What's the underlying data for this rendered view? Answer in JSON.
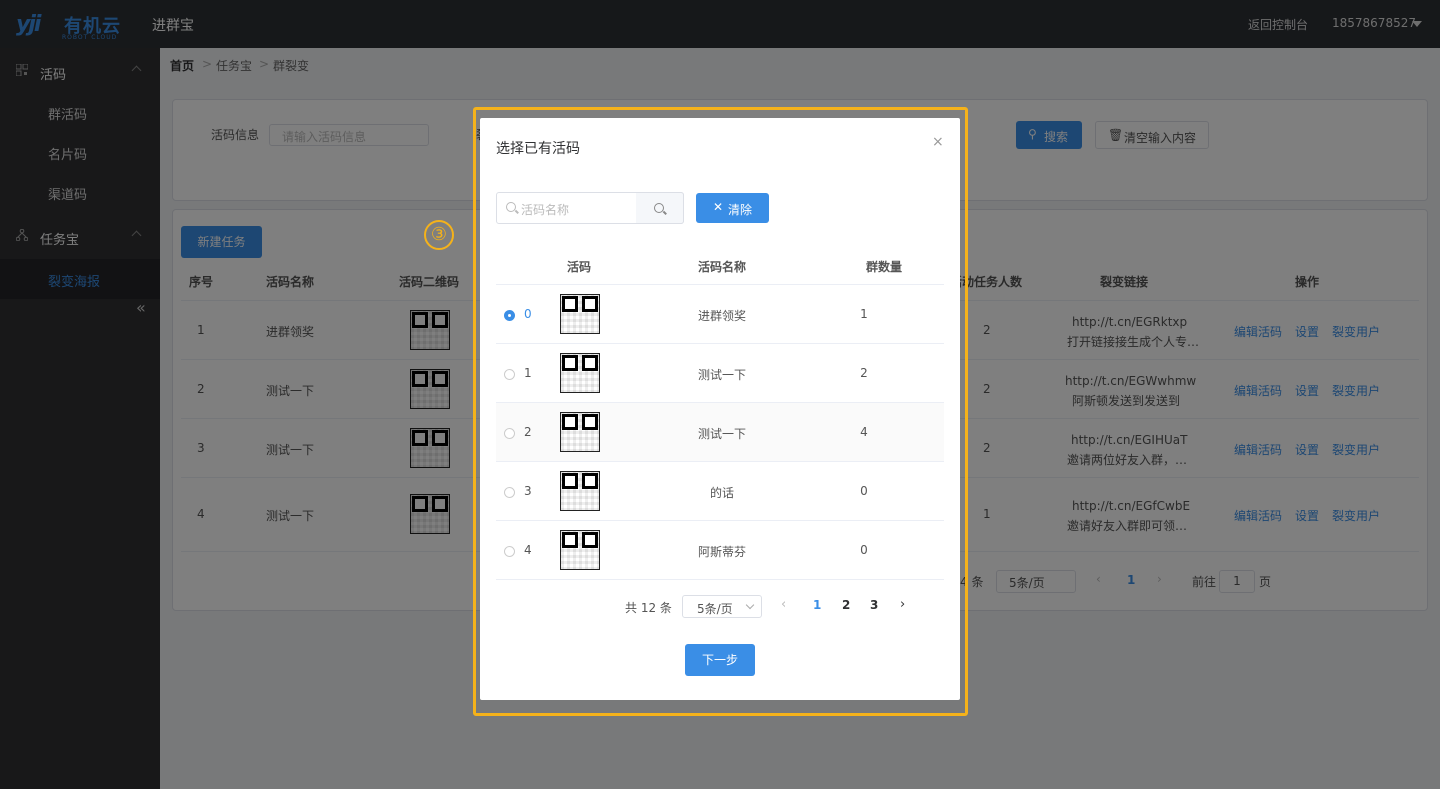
{
  "header": {
    "logo_mark": "yji",
    "logo_name": "有机云",
    "logo_sub": "ROBOT CLOUD",
    "app_title": "进群宝",
    "back_link": "返回控制台",
    "user": "18578678527"
  },
  "sidebar": {
    "groups": [
      {
        "label": "活码",
        "items": [
          "群活码",
          "名片码",
          "渠道码"
        ]
      },
      {
        "label": "任务宝",
        "items": [
          "裂变海报"
        ]
      }
    ],
    "collapse_icon": "«"
  },
  "breadcrumb": [
    "首页",
    "任务宝",
    "群裂变"
  ],
  "breadcrumb_sep": ">",
  "filter": {
    "label": "活码信息",
    "placeholder": "请输入活码信息",
    "hidden_label_fragment": "裂",
    "search_button": "搜索",
    "clear_button": "清空输入内容"
  },
  "bg_table": {
    "new_button": "新建任务",
    "headers": [
      "序号",
      "活码名称",
      "活码二维码",
      "活动任务人数",
      "裂变链接",
      "操作"
    ],
    "rows": [
      {
        "no": "1",
        "name": "进群领奖",
        "count": "2",
        "link": "http://t.cn/EGRktxp",
        "desc": "打开链接接生成个人专…"
      },
      {
        "no": "2",
        "name": "测试一下",
        "count": "2",
        "link": "http://t.cn/EGWwhmw",
        "desc": "阿斯顿发送到发送到"
      },
      {
        "no": "3",
        "name": "测试一下",
        "count": "2",
        "link": "http://t.cn/EGIHUaT",
        "desc": "邀请两位好友入群，…"
      },
      {
        "no": "4",
        "name": "测试一下",
        "count": "1",
        "link": "http://t.cn/EGfCwbE",
        "desc": "邀请好友入群即可领…"
      }
    ],
    "actions": [
      "编辑活码",
      "设置",
      "裂变用户"
    ],
    "pager": {
      "total_fragment": "4 条",
      "page_size": "5条/页",
      "page": "1",
      "goto_label": "前往",
      "goto_value": "1",
      "goto_suffix": "页"
    }
  },
  "step_badge": "③",
  "dialog": {
    "title": "选择已有活码",
    "close_icon": "×",
    "search_placeholder": "活码名称",
    "clear_label": "清除",
    "clear_icon": "✕",
    "columns": [
      "活码",
      "活码名称",
      "群数量"
    ],
    "rows": [
      {
        "index": "0",
        "name": "进群领奖",
        "count": "1",
        "selected": true
      },
      {
        "index": "1",
        "name": "测试一下",
        "count": "2",
        "selected": false
      },
      {
        "index": "2",
        "name": "测试一下",
        "count": "4",
        "selected": false
      },
      {
        "index": "3",
        "name": "的话",
        "count": "0",
        "selected": false
      },
      {
        "index": "4",
        "name": "阿斯蒂芬",
        "count": "0",
        "selected": false
      }
    ],
    "pager": {
      "total": "共 12 条",
      "page_size": "5条/页",
      "pages": [
        "1",
        "2",
        "3"
      ],
      "current": "1",
      "prev": "‹",
      "next": "›"
    },
    "next_button": "下一步"
  },
  "colors": {
    "primary": "#3a8ee6",
    "highlight": "#f5b21a",
    "sidebar": "#303133",
    "header": "#2d3035"
  }
}
